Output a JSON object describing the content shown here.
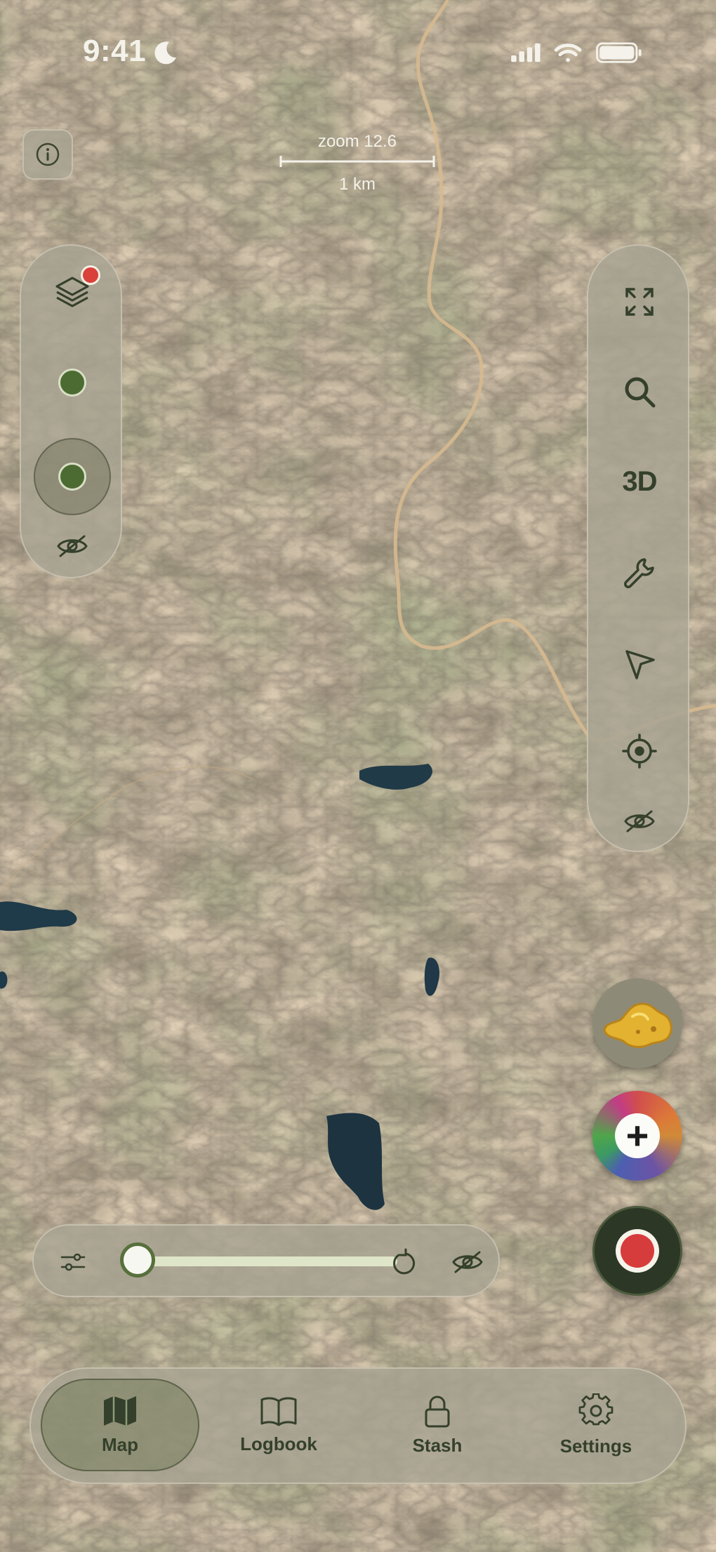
{
  "status_bar": {
    "time": "9:41"
  },
  "map": {
    "zoom_label": "zoom 12.6",
    "scale_label": "1 km"
  },
  "left_rail": {
    "items": [
      {
        "icon": "layers-icon",
        "has_badge": true
      },
      {
        "icon": "green-dot-icon"
      },
      {
        "icon": "green-dot-selected-icon"
      },
      {
        "icon": "eye-off-icon"
      }
    ]
  },
  "right_rail": {
    "items": [
      {
        "icon": "fullscreen-icon"
      },
      {
        "icon": "search-icon"
      },
      {
        "icon": "3d-toggle",
        "label": "3D"
      },
      {
        "icon": "wrench-icon"
      },
      {
        "icon": "navigation-arrow-icon"
      },
      {
        "icon": "locate-icon"
      },
      {
        "icon": "eye-off-icon"
      }
    ]
  },
  "fabs": {
    "nugget": {
      "icon": "gold-nugget-icon"
    },
    "add": {
      "icon": "plus-icon",
      "symbol": "+"
    },
    "record": {
      "icon": "record-icon"
    }
  },
  "slider": {
    "value": 0.0,
    "icons": [
      "sliders-icon",
      "reset-icon",
      "eye-off-icon"
    ]
  },
  "tabbar": {
    "tabs": [
      {
        "label": "Map",
        "icon": "map-icon",
        "active": true
      },
      {
        "label": "Logbook",
        "icon": "book-icon",
        "active": false
      },
      {
        "label": "Stash",
        "icon": "lock-icon",
        "active": false
      },
      {
        "label": "Settings",
        "icon": "gear-icon",
        "active": false
      }
    ]
  },
  "colors": {
    "accent": "#58703c",
    "record": "#d63c3b",
    "badge": "#d9413a"
  }
}
